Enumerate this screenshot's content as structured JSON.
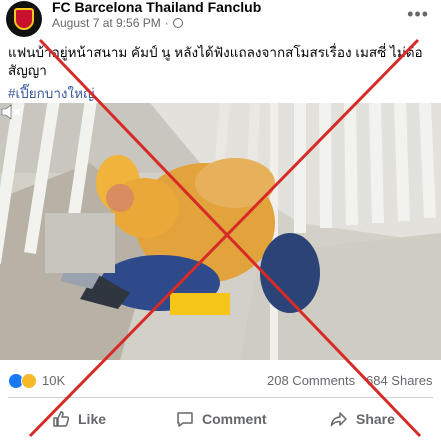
{
  "post": {
    "page_name": "FC Barcelona Thailand Fanclub",
    "timestamp": "August 7 at 9:56 PM",
    "more_label": "•••",
    "caption": "แฟนบ้าอยู่หน้าสนาม คัมป์ นู หลังได้ฟังแถลงจากสโมสรเรื่อง เมสซี่ ไม่ต่อสัญญา",
    "hashtag": "#เปี๊ยกบางใหญ่",
    "icons": [
      "globe-icon",
      "more-options-icon",
      "sound-off-icon",
      "like-reaction-icon",
      "sad-reaction-icon"
    ]
  },
  "stats": {
    "reaction_count": "10K",
    "comments": "208 Comments",
    "shares": "684 Shares"
  },
  "actions": {
    "like": "Like",
    "comment": "Comment",
    "share": "Share"
  },
  "colors": {
    "cross": "#d62b27",
    "link": "#385898",
    "muted": "#65676b"
  }
}
